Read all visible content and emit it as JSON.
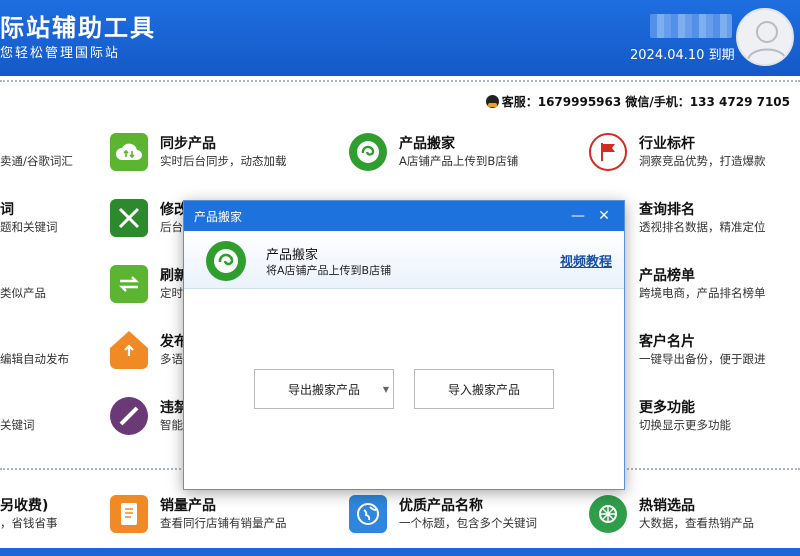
{
  "header": {
    "title": "际站辅助工具",
    "subtitle": "您轻松管理国际站",
    "expire": "2024.04.10 到期"
  },
  "contact": {
    "text": "客服：1679995963  微信/手机：133 4729 7105"
  },
  "tiles": [
    {
      "title": "",
      "desc": "卖通/谷歌词汇"
    },
    {
      "title": "同步产品",
      "desc": "实时后台同步，动态加载"
    },
    {
      "title": "产品搬家",
      "desc": "A店铺产品上传到B店铺"
    },
    {
      "title": "行业标杆",
      "desc": "洞察竞品优势，打造爆款"
    },
    {
      "title": "词",
      "desc": "题和关键词"
    },
    {
      "title": "修改",
      "desc": "后台"
    },
    {
      "title": "查询排名",
      "desc": "透视排名数据，精准定位"
    },
    {
      "title": "",
      "desc": "类似产品"
    },
    {
      "title": "刷新",
      "desc": "定时"
    },
    {
      "title": "产品榜单",
      "desc": "跨境电商，产品排名榜单"
    },
    {
      "title": "",
      "desc": "编辑自动发布"
    },
    {
      "title": "发布",
      "desc": "多语"
    },
    {
      "title": "客户名片",
      "desc": "一键导出备份，便于跟进"
    },
    {
      "title": "",
      "desc": "关键词"
    },
    {
      "title": "违禁",
      "desc": "智能"
    },
    {
      "title": "更多功能",
      "desc": "切换显示更多功能"
    },
    {
      "title": "另收费)",
      "desc": "，省钱省事"
    },
    {
      "title": "销量产品",
      "desc": "查看同行店铺有销量产品"
    },
    {
      "title": "优质产品名称",
      "desc": "一个标题，包含多个关键词"
    },
    {
      "title": "热销选品",
      "desc": "大数据，查看热销产品"
    }
  ],
  "dialog": {
    "title": "产品搬家",
    "heading": "产品搬家",
    "subheading": "将A店铺产品上传到B店铺",
    "video_link": "视频教程",
    "export_btn": "导出搬家产品",
    "import_btn": "导入搬家产品",
    "minimize": "—",
    "close": "✕"
  },
  "colors": {
    "header_blue": "#1e6ee0",
    "green": "#5cb531",
    "red": "#d32a22",
    "orange": "#f08a24",
    "purple": "#6a3a76",
    "blue": "#2f86dc"
  }
}
